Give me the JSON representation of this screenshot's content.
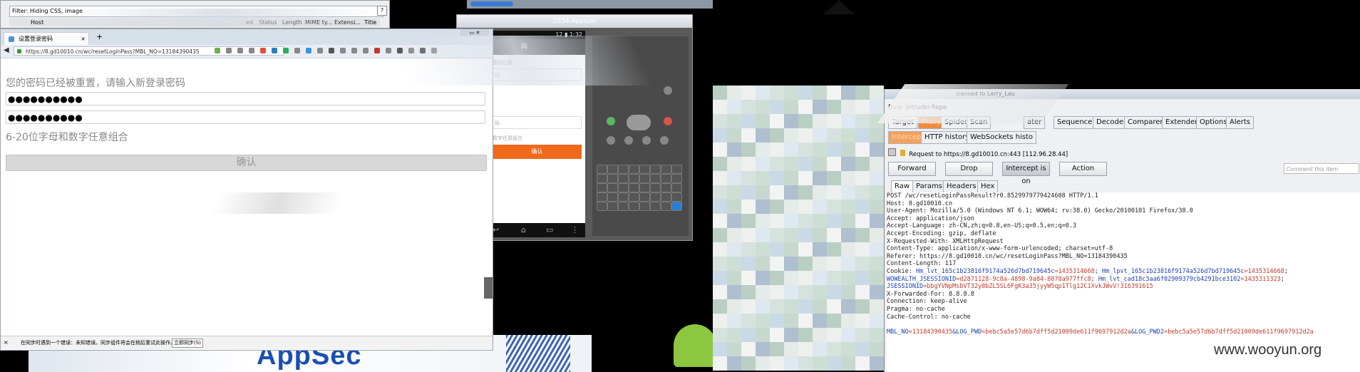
{
  "top_window": {
    "filter_text": "Filter: Hiding CSS, image",
    "host_col": "Host",
    "columns": [
      "ed",
      "Status",
      "Length",
      "MIME ty...",
      "Extensi...",
      "Title"
    ],
    "help": "?"
  },
  "browser": {
    "tab_title": "设置登录密码",
    "new_tab": "+",
    "url": "https://8.gd10010.cn/wc/resetLoginPass?MBL_NO=13184390435",
    "heading": "您的密码已经被重置，请输入新登录密码",
    "password1": "●●●●●●●●●●",
    "password2": "●●●●●●●●●●",
    "hint": "6-20位字母和数字任意组合",
    "confirm": "确认",
    "status_text": "在同步时遇到一个错误：未知错误。同步组件将会在稍后重试此操作。",
    "sync_button": "立即同步(S)",
    "close": "×"
  },
  "emulator": {
    "title": "5554:Appium",
    "status_time": "1:32",
    "status_signal": "12",
    "app_title": "码",
    "labels": [
      "密码已重",
      "码",
      "码",
      "数字任意组合"
    ],
    "confirm": "确认"
  },
  "burp": {
    "title_fragment": "icensed to Larry_Lau",
    "menu": [
      "Burp",
      "Intruder",
      "Repe"
    ],
    "tabs": [
      "Target",
      "Proxy",
      "Spider",
      "Scan",
      "ater",
      "Sequencer",
      "Decoder",
      "Comparer",
      "Extender",
      "Options",
      "Alerts"
    ],
    "sub_tabs": [
      "Intercept",
      "HTTP history",
      "WebSockets histo"
    ],
    "request_to": "Request to https://8.gd10010.cn:443  [112.96.28.44]",
    "buttons": {
      "forward": "Forward",
      "drop": "Drop",
      "intercept": "Intercept is on",
      "action": "Action"
    },
    "comment_placeholder": "Comment this item",
    "view_tabs": [
      "Raw",
      "Params",
      "Headers",
      "Hex"
    ],
    "request_lines": [
      "POST /wc/resetLoginPassResult?r0.8529979779424608 HTTP/1.1",
      "Host: 8.gd10010.cn",
      "User-Agent: Mozilla/5.0 (Windows NT 6.1; WOW64; rv:38.0) Gecko/20100101 Firefox/38.0",
      "Accept: application/json",
      "Accept-Language: zh-CN,zh;q=0.8,en-US;q=0.5,en;q=0.3",
      "Accept-Encoding: gzip, deflate",
      "X-Requested-With: XMLHttpRequest",
      "Content-Type: application/x-www-form-urlencoded; charset=utf-8",
      "Referer: https://8.gd10010.cn/wc/resetLoginPass?MBL_NO=13184390435",
      "Content-Length: 117"
    ],
    "cookie_key": "Cookie: ",
    "cookie_a_name": "Hm_lvt_165c1b23816f9174a526d7bd719645c",
    "cookie_a_val": "=1435314668",
    "cookie_b_name": "; Hm_lpvt_165c1b23816f9174a526d7bd719645c",
    "cookie_b_val": "=1435314668",
    "cookie_b_end": ";",
    "cookie_c_name": "WOWEALTH_JSESSIONID",
    "cookie_c_val": "=d2871128-9c8a-4898-9a84-8078a977ffc8",
    "cookie_d_name": "; Hm_lvt_cad18c3aa6f02909379cb4291bce3102",
    "cookie_d_val": "=1435311323",
    "cookie_d_end": ";",
    "cookie_e_name": "JSESSIONID",
    "cookie_e_val": "=bbgYVNpMsbVT32y8bZL5SL6FgK3a35jyyW5qp1Tlg12C1XvkJWvV!316391615",
    "tail_lines": [
      "X-Forwarded-For: 8.8.8.8",
      "Connection: keep-alive",
      "Pragma: no-cache",
      "Cache-Control: no-cache"
    ],
    "body_a_name": "MBL_NO",
    "body_a_val": "=13184390435",
    "body_b_name": "&LOG_PWD",
    "body_b_val": "=bebc5a5e57d6b7dff5d21009de611f9697912d2a",
    "body_c_name": "&LOG_PWD2",
    "body_c_val": "=bebc5a5e57d6b7dff5d21009de611f9697912d2a"
  },
  "banner": {
    "text": "AppSec"
  },
  "watermark": "www.wooyun.org",
  "colors": {
    "accent_orange": "#ef6a1b",
    "watermark": "#333333"
  }
}
